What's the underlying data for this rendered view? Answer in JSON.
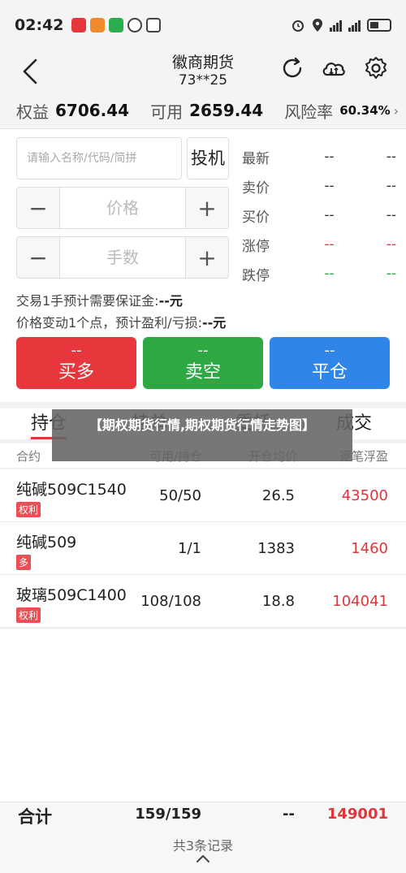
{
  "status_bar": {
    "time": "02:42",
    "icons": [
      "app-icon-red",
      "app-icon-orange",
      "wechat-icon",
      "app-icon",
      "nfc-icon"
    ],
    "right_icons": [
      "alarm-icon",
      "location-icon",
      "signal-icon",
      "signal-icon",
      "battery-icon"
    ]
  },
  "header": {
    "title": "徽商期货",
    "account": "73**25",
    "icons": [
      "back-icon",
      "refresh-icon",
      "cloud-sync-icon",
      "settings-icon"
    ]
  },
  "equity": {
    "equity_label": "权益",
    "equity_value": "6706.44",
    "available_label": "可用",
    "available_value": "2659.44",
    "risk_label": "风险率",
    "risk_value": "60.34%",
    "risk_arrow": "›"
  },
  "order": {
    "search_placeholder": "请输入名称/代码/简拼",
    "mode_button": "投机",
    "price_placeholder": "价格",
    "qty_placeholder": "手数",
    "minus": "−",
    "plus": "+",
    "quotes": [
      {
        "label": "最新",
        "v1": "--",
        "v2": "--",
        "color": "normal"
      },
      {
        "label": "卖价",
        "v1": "--",
        "v2": "--",
        "color": "normal"
      },
      {
        "label": "买价",
        "v1": "--",
        "v2": "--",
        "color": "normal"
      },
      {
        "label": "涨停",
        "v1": "--",
        "v2": "--",
        "color": "red"
      },
      {
        "label": "跌停",
        "v1": "--",
        "v2": "--",
        "color": "green"
      }
    ],
    "margin_text": "交易1手预计需要保证金:",
    "margin_value": "--元",
    "pnl_text": "价格变动1个点，预计盈利/亏损:",
    "pnl_value": "--元",
    "buy": {
      "dash": "--",
      "label": "买多",
      "color": "#e8373c"
    },
    "sell": {
      "dash": "--",
      "label": "卖空",
      "color": "#2ea843"
    },
    "close": {
      "dash": "--",
      "label": "平仓",
      "color": "#2f86e8"
    }
  },
  "tabs": {
    "positions": "持仓",
    "orders": "挂单",
    "cancel": "委托",
    "deals": "成交"
  },
  "overlay_title": "【期权期货行情,期权期货行情走势图】",
  "table": {
    "headers": {
      "contract": "合约",
      "qty": "可用/持仓",
      "price": "开仓均价",
      "pl": "逐笔浮盈"
    },
    "rows": [
      {
        "name": "纯碱509C1540",
        "tag": "权利",
        "qty": "50/50",
        "price": "26.5",
        "pl": "43500"
      },
      {
        "name": "纯碱509",
        "tag": "多",
        "qty": "1/1",
        "price": "1383",
        "pl": "1460"
      },
      {
        "name": "玻璃509C1400",
        "tag": "权利",
        "qty": "108/108",
        "price": "18.8",
        "pl": "104041"
      }
    ]
  },
  "footer": {
    "total_label": "合计",
    "total_qty": "159/159",
    "total_price": "--",
    "total_pl": "149001",
    "record_count": "共3条记录"
  }
}
